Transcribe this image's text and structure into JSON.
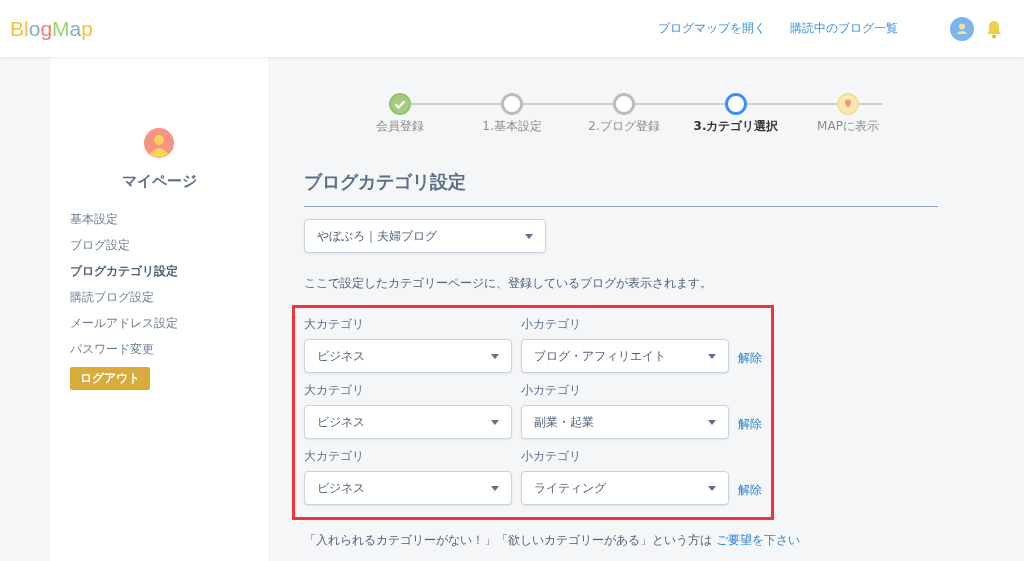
{
  "header": {
    "logo": "BlogMap",
    "nav": [
      "ブログマップを開く",
      "購読中のブログ一覧"
    ]
  },
  "sidebar": {
    "title": "マイページ",
    "items": [
      {
        "label": "基本設定",
        "selected": false
      },
      {
        "label": "ブログ設定",
        "selected": false
      },
      {
        "label": "ブログカテゴリ設定",
        "selected": true
      },
      {
        "label": "購読ブログ設定",
        "selected": false
      },
      {
        "label": "メールアドレス設定",
        "selected": false
      },
      {
        "label": "パスワード変更",
        "selected": false
      }
    ],
    "logout": "ログアウト"
  },
  "steps": [
    {
      "label": "会員登録",
      "kind": "circle",
      "done": true,
      "selected": false
    },
    {
      "label": "1.基本設定",
      "kind": "circle",
      "done": false,
      "selected": false
    },
    {
      "label": "2.ブログ登録",
      "kind": "circle",
      "done": false,
      "selected": false
    },
    {
      "label": "3.カテゴリ選択",
      "kind": "circle",
      "done": false,
      "selected": true
    },
    {
      "label": "MAPに表示",
      "kind": "pin",
      "done": false,
      "selected": false
    }
  ],
  "title": "ブログカテゴリ設定",
  "blog_select": "やぼぶろ｜夫婦ブログ",
  "description": "ここで設定したカテゴリーページに、登録しているブログが表示されます。",
  "categories": [
    {
      "major_label": "大カテゴリ",
      "major": "ビジネス",
      "minor_label": "小カテゴリ",
      "minor": "ブログ・アフィリエイト",
      "remove": "解除"
    },
    {
      "major_label": "大カテゴリ",
      "major": "ビジネス",
      "minor_label": "小カテゴリ",
      "minor": "副業・起業",
      "remove": "解除"
    },
    {
      "major_label": "大カテゴリ",
      "major": "ビジネス",
      "minor_label": "小カテゴリ",
      "minor": "ライティング",
      "remove": "解除"
    }
  ],
  "footer_note": {
    "text": "「入れられるカテゴリーがない！」「欲しいカテゴリーがある」という方は",
    "link": "ご要望を下さい"
  }
}
